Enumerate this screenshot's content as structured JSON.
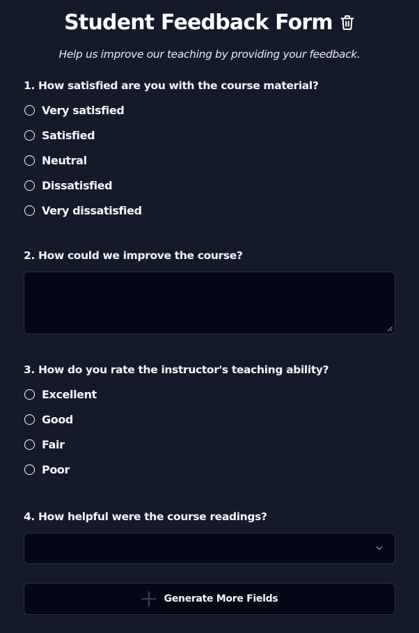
{
  "form": {
    "title": "Student Feedback Form",
    "subtitle": "Help us improve our teaching by providing your feedback.",
    "delete_icon": "trash-icon"
  },
  "questions": [
    {
      "label": "1. How satisfied are you with the course material?",
      "type": "radio",
      "options": [
        "Very satisfied",
        "Satisfied",
        "Neutral",
        "Dissatisfied",
        "Very dissatisfied"
      ]
    },
    {
      "label": "2. How could we improve the course?",
      "type": "textarea",
      "value": ""
    },
    {
      "label": "3. How do you rate the instructor's teaching ability?",
      "type": "radio",
      "options": [
        "Excellent",
        "Good",
        "Fair",
        "Poor"
      ]
    },
    {
      "label": "4. How helpful were the course readings?",
      "type": "select",
      "selected": ""
    }
  ],
  "actions": {
    "generate_label": "Generate More Fields",
    "generate_icon": "plus-icon"
  },
  "colors": {
    "background": "#141a2a",
    "field_background": "#040815",
    "field_border": "#2a3142",
    "text": "#ffffff"
  }
}
